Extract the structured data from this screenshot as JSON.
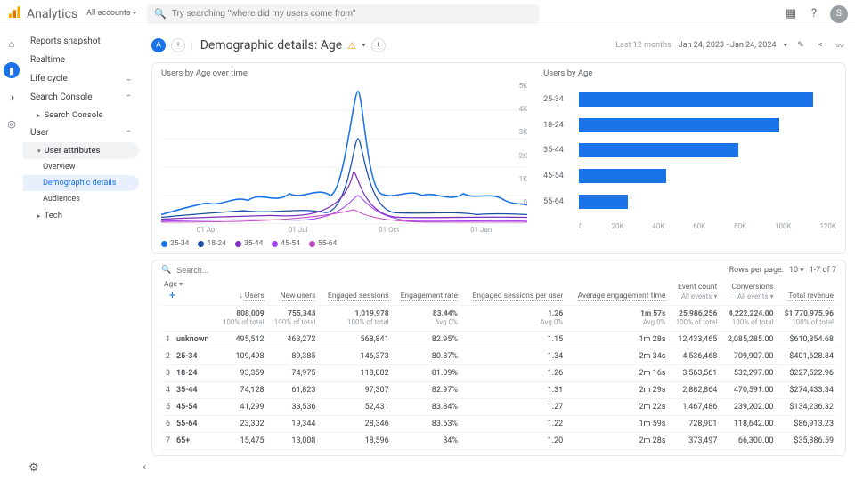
{
  "product": "Analytics",
  "account": {
    "label": "All accounts"
  },
  "search": {
    "placeholder": "Try searching \"where did my users come from\""
  },
  "avatar": "S",
  "sidebar": {
    "snapshot": "Reports snapshot",
    "realtime": "Realtime",
    "lifecycle": "Life cycle",
    "searchconsole": "Search Console",
    "searchconsole2": "Search Console",
    "user": "User",
    "userattr": "User attributes",
    "overview": "Overview",
    "demo": "Demographic details",
    "audiences": "Audiences",
    "tech": "Tech"
  },
  "page": {
    "circle_a": "A",
    "title": "Demographic details: Age",
    "daterange_label": "Last 12 months",
    "daterange": "Jan 24, 2023 - Jan 24, 2024"
  },
  "chart_data": [
    {
      "type": "line",
      "title": "Users by Age over time",
      "xticks": [
        "01 Apr",
        "01 Jul",
        "01 Oct",
        "01 Jan"
      ],
      "yticks": [
        "5K",
        "4K",
        "3K",
        "2K",
        "1K",
        "0"
      ],
      "series": [
        {
          "name": "25-34",
          "color": "#1a73e8"
        },
        {
          "name": "18-24",
          "color": "#174ea6"
        },
        {
          "name": "35-44",
          "color": "#7b2fbf"
        },
        {
          "name": "45-54",
          "color": "#a142f4"
        },
        {
          "name": "55-64",
          "color": "#c549c5"
        }
      ]
    },
    {
      "type": "bar",
      "title": "Users by Age",
      "categories": [
        "25-34",
        "18-24",
        "35-44",
        "45-54",
        "55-64"
      ],
      "values": [
        109498,
        93359,
        74128,
        41299,
        23302
      ],
      "xticks": [
        "0",
        "20K",
        "40K",
        "60K",
        "80K",
        "100K",
        "120K"
      ],
      "xlim": [
        0,
        120000
      ]
    }
  ],
  "table": {
    "search_ph": "Search...",
    "rows_per_page_label": "Rows per page:",
    "rows_per_page": "10",
    "range": "1-7 of 7",
    "age_col": "Age",
    "plus": "+",
    "headers": [
      "Users",
      "New users",
      "Engaged sessions",
      "Engagement rate",
      "Engaged sessions per user",
      "Average engagement time",
      "Event count",
      "Conversions",
      "Total revenue"
    ],
    "header_sub": [
      "",
      "",
      "",
      "",
      "",
      "",
      "All events",
      "All events",
      ""
    ],
    "totals": {
      "vals": [
        "808,009",
        "755,343",
        "1,019,978",
        "83.44%",
        "1.26",
        "1m 57s",
        "25,986,256",
        "4,222,224.00",
        "$1,770,975.96"
      ],
      "subs": [
        "100% of total",
        "100% of total",
        "100% of total",
        "Avg 0%",
        "Avg 0%",
        "Avg 0%",
        "100% of total",
        "100% of total",
        "100% of total"
      ]
    },
    "rows": [
      {
        "i": "1",
        "age": "unknown",
        "v": [
          "495,512",
          "463,272",
          "568,841",
          "82.95%",
          "1.15",
          "1m 28s",
          "12,433,465",
          "2,085,285.00",
          "$610,854.68"
        ]
      },
      {
        "i": "2",
        "age": "25-34",
        "v": [
          "109,498",
          "89,385",
          "146,373",
          "80.87%",
          "1.34",
          "2m 34s",
          "4,536,468",
          "709,907.00",
          "$401,628.84"
        ]
      },
      {
        "i": "3",
        "age": "18-24",
        "v": [
          "93,359",
          "74,975",
          "118,002",
          "81.09%",
          "1.26",
          "2m 16s",
          "3,563,561",
          "532,297.00",
          "$227,522.96"
        ]
      },
      {
        "i": "4",
        "age": "35-44",
        "v": [
          "74,128",
          "61,823",
          "97,307",
          "82.97%",
          "1.31",
          "2m 29s",
          "2,882,864",
          "470,591.00",
          "$274,433.34"
        ]
      },
      {
        "i": "5",
        "age": "45-54",
        "v": [
          "41,299",
          "33,536",
          "52,431",
          "83.84%",
          "1.27",
          "2m 22s",
          "1,467,486",
          "239,202.00",
          "$134,236.32"
        ]
      },
      {
        "i": "6",
        "age": "55-64",
        "v": [
          "23,302",
          "19,344",
          "28,346",
          "83.53%",
          "1.22",
          "1m 59s",
          "728,901",
          "118,642.00",
          "$86,913.23"
        ]
      },
      {
        "i": "7",
        "age": "65+",
        "v": [
          "15,475",
          "13,008",
          "18,596",
          "84%",
          "1.20",
          "2m 28s",
          "373,497",
          "66,300.00",
          "$35,386.59"
        ]
      }
    ]
  }
}
